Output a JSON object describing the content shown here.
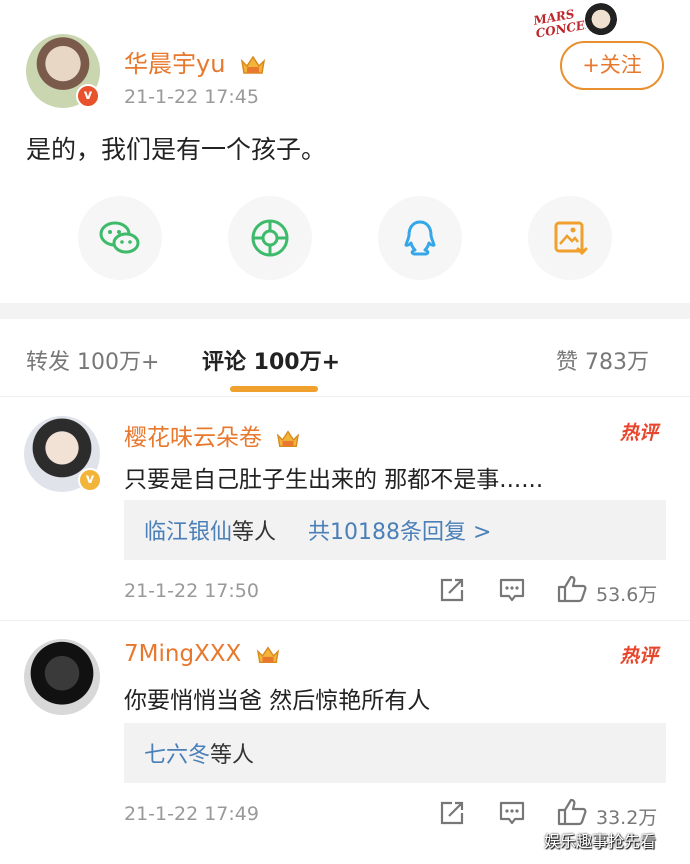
{
  "post": {
    "username": "华晨宇yu",
    "time": "21-1-22 17:45",
    "text": "是的，我们是有一个孩子。",
    "follow_label": "+关注",
    "concert_logo": "MARS CONCERT",
    "verified_mark": "v"
  },
  "share_icons": [
    "wechat-icon",
    "moments-icon",
    "qq-icon",
    "save-image-icon"
  ],
  "tabs": {
    "repost": "转发 100万+",
    "comments": "评论 100万+",
    "likes": "赞 783万"
  },
  "comments": [
    {
      "username": "樱花味云朵卷",
      "tag": "热评",
      "text": "只要是自己肚子生出来的 那都不是事......",
      "reply_who": "临江银仙",
      "reply_etc": "等人",
      "reply_count": "共10188条回复 >",
      "time": "21-1-22 17:50",
      "likes": "53.6万"
    },
    {
      "username": "7MingXXX",
      "tag": "热评",
      "text": "你要悄悄当爸 然后惊艳所有人",
      "reply_who": "七六冬",
      "reply_etc": "等人",
      "time": "21-1-22 17:49",
      "likes": "33.2万"
    }
  ],
  "watermark": "娱乐趣事抢先看",
  "colors": {
    "username": "#e8782d",
    "link": "#4a7fb8",
    "hot": "#e8452d",
    "accent": "#f0a02d"
  }
}
